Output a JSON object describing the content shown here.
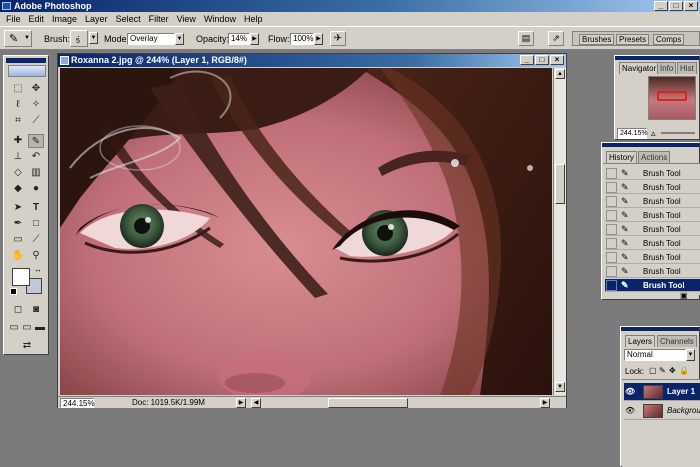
{
  "app": {
    "title": "Adobe Photoshop"
  },
  "menu": [
    "File",
    "Edit",
    "Image",
    "Layer",
    "Select",
    "Filter",
    "View",
    "Window",
    "Help"
  ],
  "options": {
    "brush_label": "Brush:",
    "brush_size": "5",
    "mode_label": "Mode:",
    "mode_value": "Overlay",
    "opacity_label": "Opacity:",
    "opacity_value": "14%",
    "flow_label": "Flow:",
    "flow_value": "100%"
  },
  "palette_well": {
    "tabs": [
      "Brushes",
      "Presets",
      "Comps"
    ]
  },
  "document": {
    "title": "Roxanna 2.jpg @ 244% (Layer 1, RGB/8#)",
    "zoom": "244.15%",
    "doc_info": "Doc: 1019.5K/1.99M"
  },
  "navigator": {
    "tabs": [
      "Navigator",
      "Info",
      "Hist"
    ],
    "zoom": "244.15%"
  },
  "history": {
    "tabs": [
      "History",
      "Actions"
    ],
    "items": [
      "Brush Tool",
      "Brush Tool",
      "Brush Tool",
      "Brush Tool",
      "Brush Tool",
      "Brush Tool",
      "Brush Tool",
      "Brush Tool",
      "Brush Tool"
    ],
    "selected_index": 8
  },
  "layers": {
    "tabs": [
      "Layers",
      "Channels"
    ],
    "blend_mode": "Normal",
    "lock_label": "Lock:",
    "items": [
      "Layer 1",
      "Background"
    ],
    "selected_index": 0
  },
  "colors": {
    "accent": "#0a246a",
    "chrome": "#d4d0c8",
    "workspace": "#7b7b7b"
  }
}
